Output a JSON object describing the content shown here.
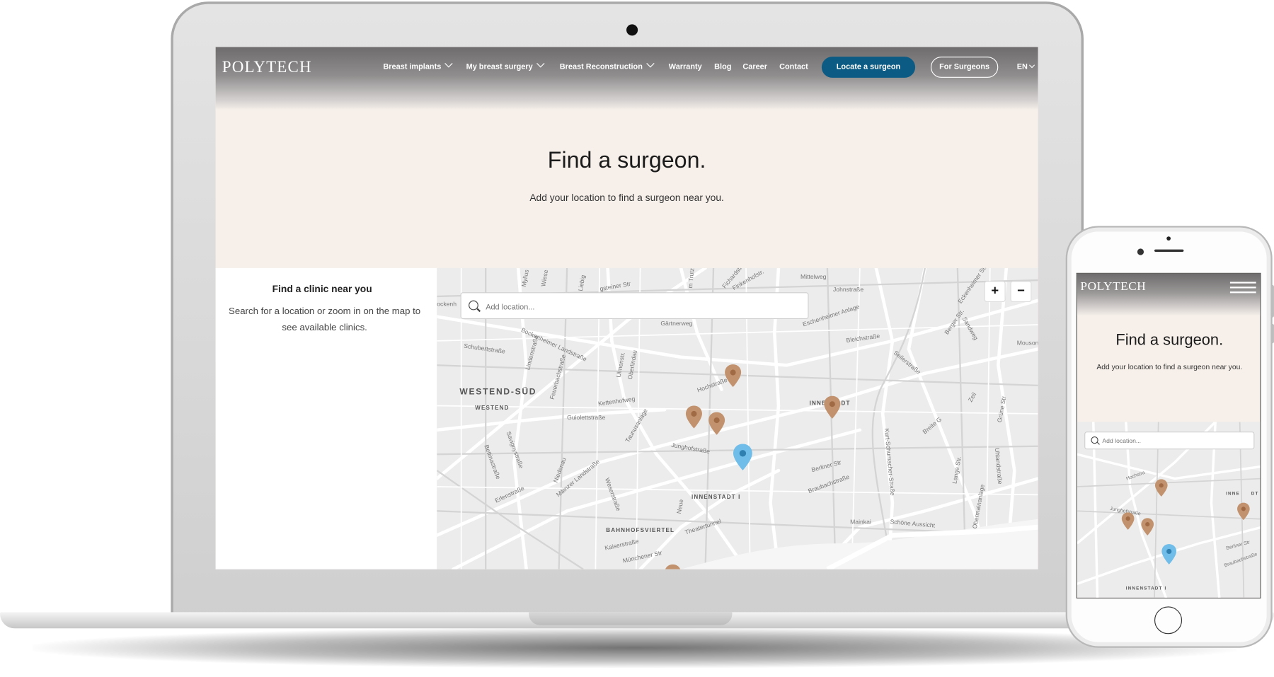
{
  "brand": {
    "logo": "POLYTECH"
  },
  "nav": {
    "items": [
      {
        "label": "Breast implants",
        "dropdown": true
      },
      {
        "label": "My breast surgery",
        "dropdown": true
      },
      {
        "label": "Breast Reconstruction",
        "dropdown": true
      },
      {
        "label": "Warranty",
        "dropdown": false
      },
      {
        "label": "Blog",
        "dropdown": false
      },
      {
        "label": "Career",
        "dropdown": false
      },
      {
        "label": "Contact",
        "dropdown": false
      }
    ],
    "locate_button": "Locate a surgeon",
    "for_surgeons_button": "For Surgeons",
    "language": "EN"
  },
  "hero": {
    "title": "Find a surgeon.",
    "subtitle": "Add your location to find a surgeon near you."
  },
  "panel": {
    "title": "Find a clinic near you",
    "text": "Search for a location or zoom in on the map to see available clinics."
  },
  "map": {
    "search_placeholder": "Add location...",
    "zoom_in": "+",
    "zoom_out": "−",
    "districts": {
      "westend_sued": "WESTEND-SÜD",
      "westend": "WESTEND",
      "innenstadt": "INNENSTADT I",
      "bahnhofsviertel": "BAHNHOFSVIERTEL",
      "innenstadt_partial": "INNE",
      "innenstadt_partial2": "DT"
    },
    "streets": {
      "mittelweg": "Mittelweg",
      "johnstrasse": "Johnstraße",
      "fichardstr": "Fichardstr.",
      "finkenhofstr": "Finkenhofstr.",
      "staufenstr": "Staufenstr.",
      "eschenheimer_anlage": "Eschenheimer Anlage",
      "bleichstrasse": "Bleichstraße",
      "seilerstrasse": "Seilerstraße",
      "bergerstr": "Berger Str.",
      "sandweg": "Sandweg",
      "eckenheimer": "Eckenheimer Str.",
      "gaertnerweg": "Gärtnerweg",
      "bockenheimer_landstrasse": "Bockenheimer Landstraße",
      "schubertstrasse": "Schubertstraße",
      "ulmenstr": "Ulmenstr.",
      "oberlindau": "Oberlindau",
      "hochstrasse": "Hochstraße",
      "kettenhofweg": "Kettenhofweg",
      "guiolettstrasse": "Guiolettstraße",
      "taunusanlage": "Taunusanlage",
      "junghofstrasse": "Junghofstraße",
      "berliner_str": "Berliner Str",
      "braubachstrasse": "Braubachstraße",
      "kurt_schumacher": "Kurt-Schumacher-Straße",
      "lange_str": "Lange Str.",
      "mainzer_landstrasse": "Mainzer Landstraße",
      "theatertunnel": "Theatertunnel",
      "mainkai": "Mainkai",
      "schoene_aussicht": "Schöne Aussicht",
      "kaiserstrasse": "Kaiserstraße",
      "muenchener_str": "Münchener Str",
      "zeil": "Zeil",
      "bettinastrasse": "Bettinastraße",
      "savignystrasse": "Savignystraße",
      "erlenstrasse": "Erlenstraße",
      "niedenau": "Niedenau",
      "weserstrasse": "Weserstraße",
      "feuerbachstrasse": "Feuerbachstraße",
      "lindenstrasse": "Lindenstraße",
      "gruene_str": "Grüne Str",
      "uhlandstrasse": "Uhlandstraße",
      "obermainanlage": "Obermainanlage",
      "mousonstr": "Mouson",
      "bockenheim": "ockenh",
      "holzhausenstr": "Liebig",
      "grueneburgweg": "Grüneburg",
      "fellnerstr": "gsteiner Str",
      "gaertnerweg2": "Mylius",
      "wiesenau": "Wiese",
      "trutz": "m Trutz",
      "koenigstein": "Königst",
      "breitegasse": "Breite G",
      "hanauer": "Hanau",
      "kiesstr": "Kies",
      "zimmerweg": "Zimmer",
      "neue_mainzer": "Neue",
      "marien": "Marien",
      "karlstrasse": "Karlstr.",
      "stift": "Stift",
      "holzgraben": "Holz",
      "roemer": "Römer"
    }
  },
  "mobile": {
    "logo": "POLYTECH",
    "title": "Find a surgeon.",
    "subtitle": "Add your location to find a surgeon near you.",
    "search_placeholder": "Add location...",
    "streets": {
      "hochstr": "Hochstra",
      "junghof": "Junghofstraße",
      "berliner": "Berliner Str",
      "braubach": "Braubachstraße",
      "innenstadt": "INNENSTADT I",
      "inne": "INNE",
      "dt": "DT"
    }
  },
  "colors": {
    "accent": "#0b5b84",
    "pin": "#c1926d",
    "pin_selected": "#6fbde8",
    "hero_bg": "#f7f0ea"
  }
}
